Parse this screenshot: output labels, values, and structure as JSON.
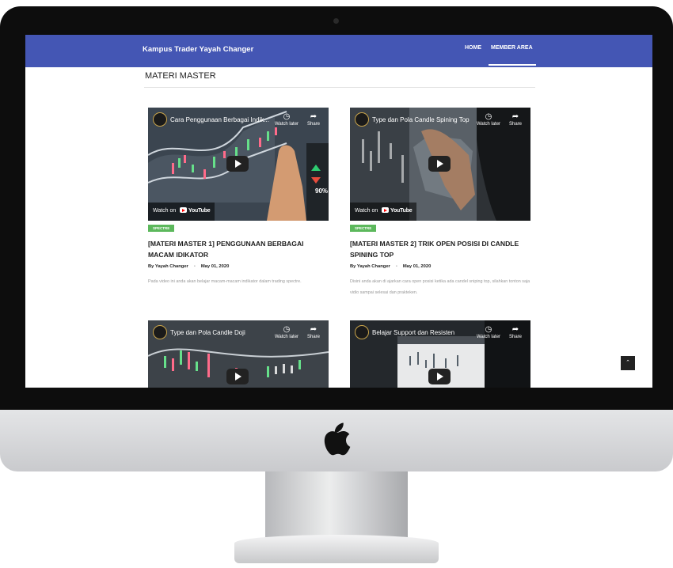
{
  "site": {
    "brand": "Kampus Trader Yayah Changer",
    "nav": [
      {
        "label": "HOME"
      },
      {
        "label": "MEMBER AREA"
      }
    ]
  },
  "page": {
    "title": "MATERI MASTER"
  },
  "video_ui": {
    "watch_later": "Watch later",
    "share": "Share",
    "watch_on": "Watch on",
    "youtube": "YouTube"
  },
  "posts": [
    {
      "video_title": "Cara Penggunaan Berbagai Indik...",
      "tag": "SPECTRE",
      "title": "[MATERI MASTER 1] PENGGUNAAN BERBAGAI MACAM IDIKATOR",
      "author": "By Yayah Changer",
      "date": "May 01, 2020",
      "excerpt": "Pada video ini anda akan belajar macam-macam indikator dalam trading spectre.",
      "overlay_pct": "90%"
    },
    {
      "video_title": "Type dan Pola Candle Spining Top",
      "tag": "SPECTRE",
      "title": "[MATERI MASTER 2] TRIK OPEN POSISI DI CANDLE SPINING TOP",
      "author": "By Yayah Changer",
      "date": "May 01, 2020",
      "excerpt": "Disini anda akan di ajarkan cara open posisi ketika ada candel sniping top, silahkan tonton saja vidio sampai selesai dan prakteken."
    },
    {
      "video_title": "Type dan Pola Candle Doji"
    },
    {
      "video_title": "Belajar Support dan Resisten"
    }
  ],
  "colors": {
    "navbar": "#4456b4",
    "tag": "#5cb85c"
  },
  "icons": [
    "apple-logo-icon",
    "clock-icon",
    "share-icon",
    "play-icon",
    "youtube-icon",
    "chevron-up-icon"
  ]
}
